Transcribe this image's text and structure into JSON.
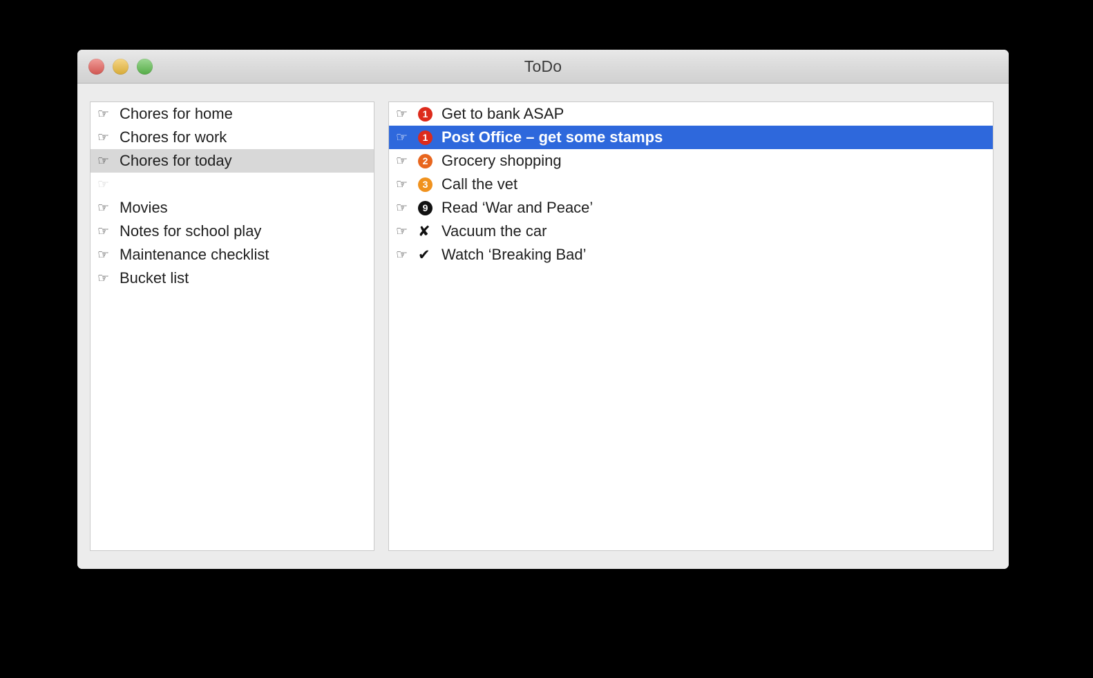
{
  "window": {
    "title": "ToDo",
    "traffic_lights": [
      {
        "name": "close",
        "color": "#e8605a"
      },
      {
        "name": "minimize",
        "color": "#f0be3e"
      },
      {
        "name": "maximize",
        "color": "#5fbf4f"
      }
    ]
  },
  "icons": {
    "hand": "☞",
    "check": "✔",
    "cross": "✘"
  },
  "colors": {
    "selection_blue": "#2e68dc",
    "selection_gray": "#d8d8d8",
    "window_bg": "#ececec",
    "panel_bg": "#ffffff",
    "panel_border": "#c9c9c9",
    "priority_1": "#dd2b1c",
    "priority_2": "#e8661e",
    "priority_3": "#f0921e",
    "priority_9": "#111111"
  },
  "sidebar": {
    "items": [
      {
        "label": "Chores for home",
        "selected": false,
        "empty": false
      },
      {
        "label": "Chores for work",
        "selected": false,
        "empty": false
      },
      {
        "label": "Chores for today",
        "selected": true,
        "empty": false
      },
      {
        "label": "",
        "selected": false,
        "empty": true
      },
      {
        "label": "Movies",
        "selected": false,
        "empty": false
      },
      {
        "label": "Notes for school play",
        "selected": false,
        "empty": false
      },
      {
        "label": "Maintenance checklist",
        "selected": false,
        "empty": false
      },
      {
        "label": "Bucket list",
        "selected": false,
        "empty": false
      }
    ]
  },
  "tasks": {
    "items": [
      {
        "label": "Get to bank ASAP",
        "badge": "1",
        "badge_type": "circle",
        "badge_color": "#dd2b1c",
        "selected": false
      },
      {
        "label": "Post Office – get some stamps",
        "badge": "1",
        "badge_type": "circle",
        "badge_color": "#dd2b1c",
        "selected": true
      },
      {
        "label": "Grocery shopping",
        "badge": "2",
        "badge_type": "circle",
        "badge_color": "#e8661e",
        "selected": false
      },
      {
        "label": "Call the vet",
        "badge": "3",
        "badge_type": "circle",
        "badge_color": "#f0921e",
        "selected": false
      },
      {
        "label": "Read ‘War and Peace’",
        "badge": "9",
        "badge_type": "circle",
        "badge_color": "#111111",
        "selected": false
      },
      {
        "label": "Vacuum the car",
        "badge": "✘",
        "badge_type": "glyph",
        "badge_color": "#111111",
        "selected": false
      },
      {
        "label": "Watch ‘Breaking Bad’",
        "badge": "✔",
        "badge_type": "glyph",
        "badge_color": "#111111",
        "selected": false
      }
    ]
  }
}
